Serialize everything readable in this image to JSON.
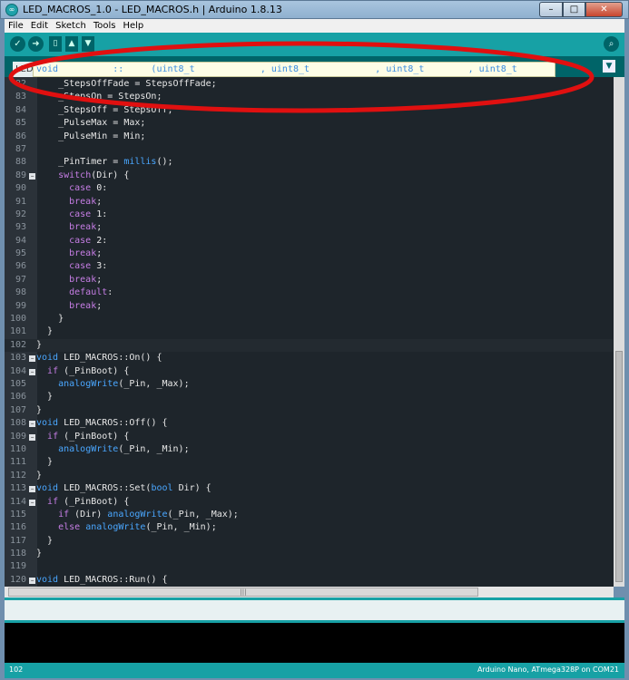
{
  "window": {
    "title": "LED_MACROS_1.0 - LED_MACROS.h | Arduino 1.8.13"
  },
  "menu": [
    "File",
    "Edit",
    "Sketch",
    "Tools",
    "Help"
  ],
  "tab": {
    "label": "LED"
  },
  "autocomplete": {
    "text": "void          ::     (uint8_t            , uint8_t            , uint8_t        , uint8_t"
  },
  "editor": {
    "lines": [
      {
        "num": "82",
        "html": "    _StepsOffFade = StepsOffFade;"
      },
      {
        "num": "83",
        "html": "    _StepsOn = StepsOn;"
      },
      {
        "num": "84",
        "html": "    _StepsOff = StepsOff;"
      },
      {
        "num": "85",
        "html": "    _PulseMax = Max;"
      },
      {
        "num": "86",
        "html": "    _PulseMin = Min;"
      },
      {
        "num": "87",
        "html": ""
      },
      {
        "num": "88",
        "html": "    _PinTimer = <span class=\"fn\">millis</span>();"
      },
      {
        "num": "89",
        "fold": true,
        "html": "    <span class=\"kw\">switch</span>(Dir) {"
      },
      {
        "num": "90",
        "html": "      <span class=\"kw\">case</span> 0:"
      },
      {
        "num": "91",
        "html": "      <span class=\"kw\">break</span>;"
      },
      {
        "num": "92",
        "html": "      <span class=\"kw\">case</span> 1:"
      },
      {
        "num": "93",
        "html": "      <span class=\"kw\">break</span>;"
      },
      {
        "num": "94",
        "html": "      <span class=\"kw\">case</span> 2:"
      },
      {
        "num": "95",
        "html": "      <span class=\"kw\">break</span>;"
      },
      {
        "num": "96",
        "html": "      <span class=\"kw\">case</span> 3:"
      },
      {
        "num": "97",
        "html": "      <span class=\"kw\">break</span>;"
      },
      {
        "num": "98",
        "html": "      <span class=\"kw\">default</span>:"
      },
      {
        "num": "99",
        "html": "      <span class=\"kw\">break</span>;"
      },
      {
        "num": "100",
        "html": "    }"
      },
      {
        "num": "101",
        "html": "  }"
      },
      {
        "num": "102",
        "html": "}",
        "current": true
      },
      {
        "num": "103",
        "fold": true,
        "html": "<span class=\"ty\">void</span> LED_MACROS::On() {"
      },
      {
        "num": "104",
        "fold": true,
        "html": "  <span class=\"kw\">if</span> (_PinBoot) {"
      },
      {
        "num": "105",
        "html": "    <span class=\"fn\">analogWrite</span>(_Pin, _Max);"
      },
      {
        "num": "106",
        "html": "  }"
      },
      {
        "num": "107",
        "html": "}"
      },
      {
        "num": "108",
        "fold": true,
        "html": "<span class=\"ty\">void</span> LED_MACROS::Off() {"
      },
      {
        "num": "109",
        "fold": true,
        "html": "  <span class=\"kw\">if</span> (_PinBoot) {"
      },
      {
        "num": "110",
        "html": "    <span class=\"fn\">analogWrite</span>(_Pin, _Min);"
      },
      {
        "num": "111",
        "html": "  }"
      },
      {
        "num": "112",
        "html": "}"
      },
      {
        "num": "113",
        "fold": true,
        "html": "<span class=\"ty\">void</span> LED_MACROS::Set(<span class=\"ty\">bool</span> Dir) {"
      },
      {
        "num": "114",
        "fold": true,
        "html": "  <span class=\"kw\">if</span> (_PinBoot) {"
      },
      {
        "num": "115",
        "html": "    <span class=\"kw\">if</span> (Dir) <span class=\"fn\">analogWrite</span>(_Pin, _Max);"
      },
      {
        "num": "116",
        "html": "    <span class=\"kw\">else</span> <span class=\"fn\">analogWrite</span>(_Pin, _Min);"
      },
      {
        "num": "117",
        "html": "  }"
      },
      {
        "num": "118",
        "html": "}"
      },
      {
        "num": "119",
        "html": ""
      },
      {
        "num": "120",
        "fold": true,
        "html": "<span class=\"ty\">void</span> LED_MACROS::Run() {"
      }
    ]
  },
  "status": {
    "line": "102",
    "board": "Arduino Nano, ATmega328P on COM21"
  },
  "annotation": {
    "color": "#e01010"
  }
}
